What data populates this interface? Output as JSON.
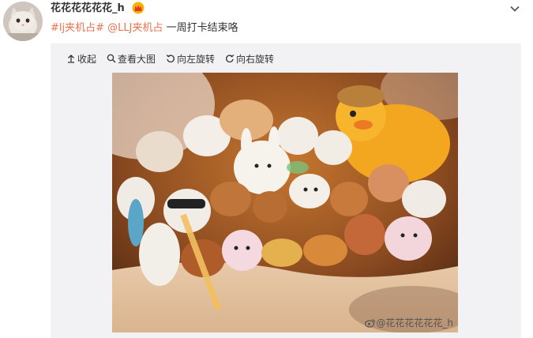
{
  "post": {
    "author": "花花花花花花_h",
    "text": {
      "tag": "#lj夹机占#",
      "mention": "@LLJ夹机占",
      "body": "一周打卡结束咯"
    }
  },
  "toolbar": {
    "collapse_label": "收起",
    "view_large_label": "查看大图",
    "rotate_left_label": "向左旋转",
    "rotate_right_label": "向右旋转"
  },
  "photo": {
    "watermark": "@花花花花花花_h"
  },
  "colors": {
    "link": "#eb7350",
    "panel": "#f2f2f5"
  }
}
